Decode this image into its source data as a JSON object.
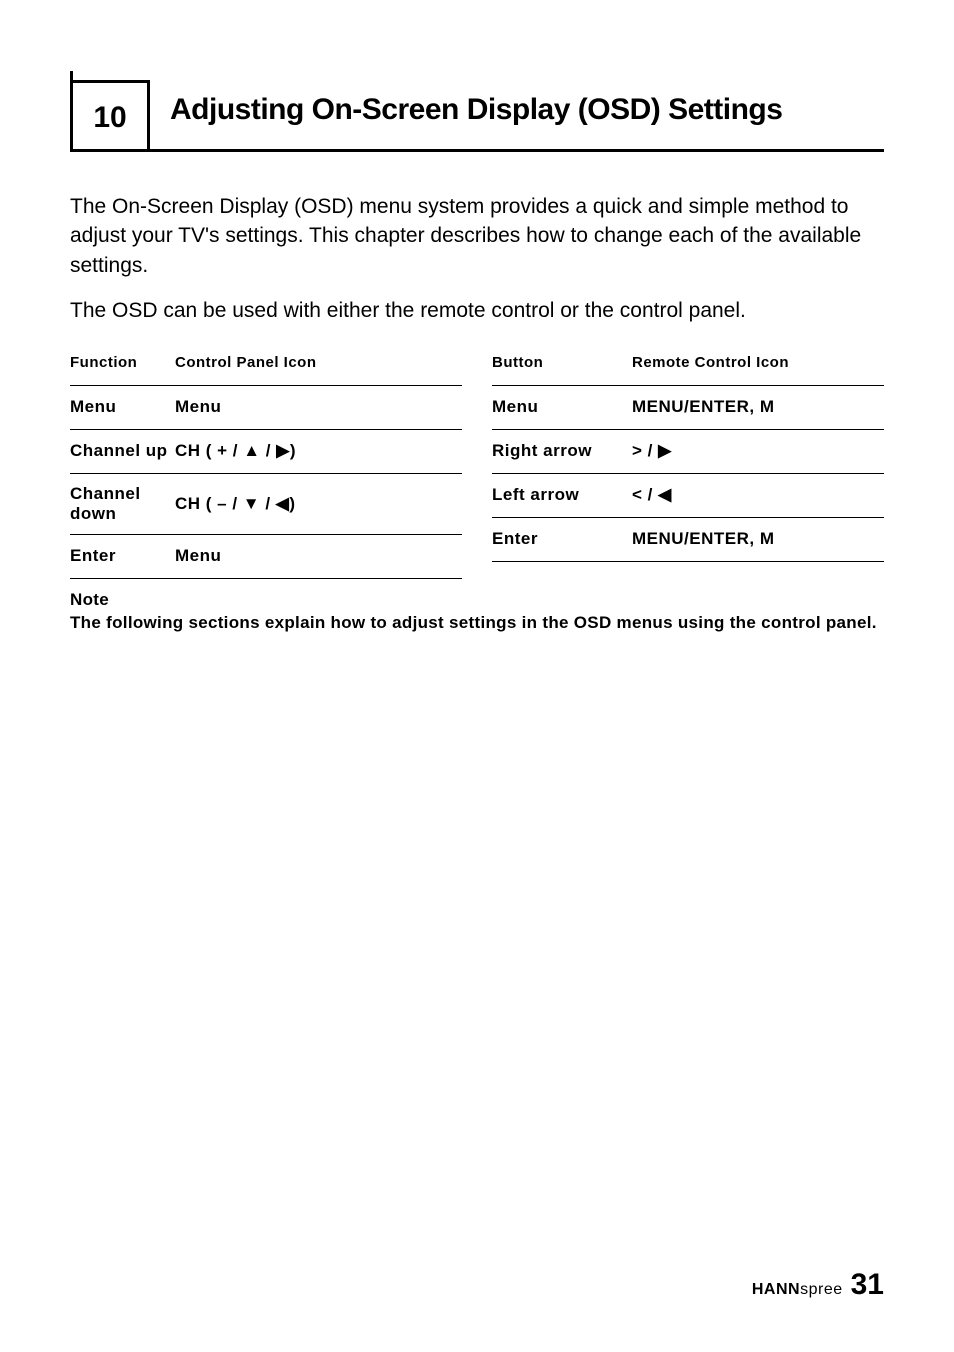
{
  "chapter": {
    "number": "10",
    "title": "Adjusting On-Screen Display (OSD) Settings"
  },
  "paragraphs": {
    "p1": "The On-Screen Display (OSD) menu system provides a quick and simple method to adjust your TV's settings. This chapter describes how to change each of the available settings.",
    "p2": "The OSD can be used with either the remote control or the control panel."
  },
  "table": {
    "left": {
      "headers": {
        "c1": "Function",
        "c2": "Control Panel Icon"
      },
      "rows": [
        {
          "c1": "Menu",
          "c2": "Menu"
        },
        {
          "c1": "Channel up",
          "c2": "CH ( + / ▲ / ▶)"
        },
        {
          "c1": "Channel down",
          "c2": "CH ( – / ▼ / ◀)"
        },
        {
          "c1": "Enter",
          "c2": "Menu"
        }
      ]
    },
    "right": {
      "headers": {
        "c1": "Button",
        "c2": "Remote Control Icon"
      },
      "rows": [
        {
          "c1": "Menu",
          "c2": "MENU/ENTER, M"
        },
        {
          "c1": "Right arrow",
          "c2": "> / ▶"
        },
        {
          "c1": "Left arrow",
          "c2": "< / ◀"
        },
        {
          "c1": "Enter",
          "c2": "MENU/ENTER, M"
        }
      ]
    }
  },
  "note": {
    "label": "Note",
    "text": "The following sections explain how to adjust settings in the OSD menus using the control panel."
  },
  "footer": {
    "logo_bold": "HANN",
    "logo_light": "spree",
    "page": "31"
  }
}
